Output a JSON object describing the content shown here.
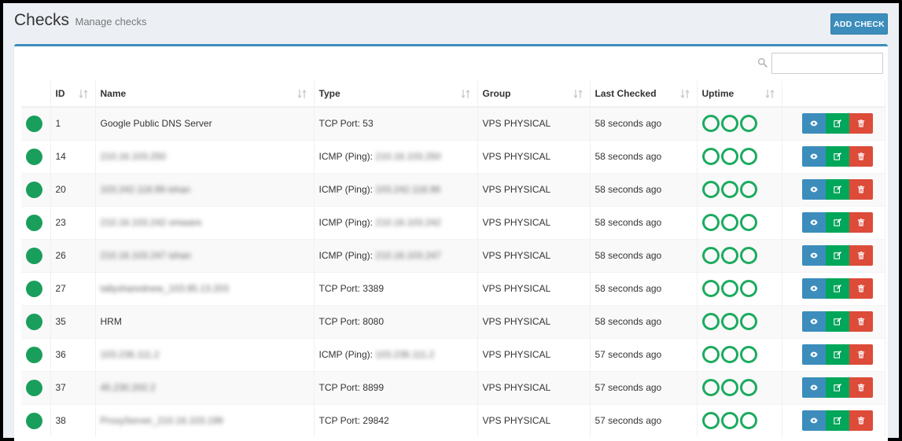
{
  "header": {
    "title": "Checks",
    "subtitle": "Manage checks",
    "add_button": "ADD CHECK"
  },
  "search": {
    "placeholder": ""
  },
  "table": {
    "columns": [
      "ID",
      "Name",
      "Type",
      "Group",
      "Last Checked",
      "Uptime"
    ],
    "rows": [
      {
        "id": "1",
        "name": "Google Public DNS Server",
        "name_blurred": false,
        "type_prefix": "TCP Port: ",
        "type_value": "53",
        "type_blurred": false,
        "group": "VPS PHYSICAL",
        "last_checked": "58 seconds ago"
      },
      {
        "id": "14",
        "name": "210.16.103.250",
        "name_blurred": true,
        "type_prefix": "ICMP (Ping): ",
        "type_value": "210.16.103.250",
        "type_blurred": true,
        "group": "VPS PHYSICAL",
        "last_checked": "58 seconds ago"
      },
      {
        "id": "20",
        "name": "103.242.118.99 ishan",
        "name_blurred": true,
        "type_prefix": "ICMP (Ping): ",
        "type_value": "103.242.118.99",
        "type_blurred": true,
        "group": "VPS PHYSICAL",
        "last_checked": "58 seconds ago"
      },
      {
        "id": "23",
        "name": "210.16.103.242 vmware",
        "name_blurred": true,
        "type_prefix": "ICMP (Ping): ",
        "type_value": "210.16.103.242",
        "type_blurred": true,
        "group": "VPS PHYSICAL",
        "last_checked": "58 seconds ago"
      },
      {
        "id": "26",
        "name": "210.16.103.247 ishan",
        "name_blurred": true,
        "type_prefix": "ICMP (Ping): ",
        "type_value": "210.16.103.247",
        "type_blurred": true,
        "group": "VPS PHYSICAL",
        "last_checked": "58 seconds ago"
      },
      {
        "id": "27",
        "name": "tallysharednew_103.95.13.203",
        "name_blurred": true,
        "type_prefix": "TCP Port: ",
        "type_value": "3389",
        "type_blurred": false,
        "group": "VPS PHYSICAL",
        "last_checked": "58 seconds ago"
      },
      {
        "id": "35",
        "name": "HRM",
        "name_blurred": false,
        "type_prefix": "TCP Port: ",
        "type_value": "8080",
        "type_blurred": false,
        "group": "VPS PHYSICAL",
        "last_checked": "58 seconds ago"
      },
      {
        "id": "36",
        "name": "103.236.111.2",
        "name_blurred": true,
        "type_prefix": "ICMP (Ping): ",
        "type_value": "103.236.111.2",
        "type_blurred": true,
        "group": "VPS PHYSICAL",
        "last_checked": "57 seconds ago"
      },
      {
        "id": "37",
        "name": "45.230.202.2",
        "name_blurred": true,
        "type_prefix": "TCP Port: ",
        "type_value": "8899",
        "type_blurred": false,
        "group": "VPS PHYSICAL",
        "last_checked": "57 seconds ago"
      },
      {
        "id": "38",
        "name": "ProxyServer_210.16.103.199",
        "name_blurred": true,
        "type_prefix": "TCP Port: ",
        "type_value": "29842",
        "type_blurred": false,
        "group": "VPS PHYSICAL",
        "last_checked": "57 seconds ago"
      }
    ]
  },
  "colors": {
    "primary": "#3c8dbc",
    "success": "#00a65a",
    "danger": "#dd4b39",
    "status_up": "#1a9e5c",
    "uptime_ring": "#1cab5f"
  },
  "icons": {
    "status": "status-up-dot",
    "uptime": "uptime-ring-icon",
    "view": "eye-icon",
    "edit": "edit-icon",
    "delete": "trash-icon",
    "sort": "sort-icon",
    "search": "search-icon"
  }
}
